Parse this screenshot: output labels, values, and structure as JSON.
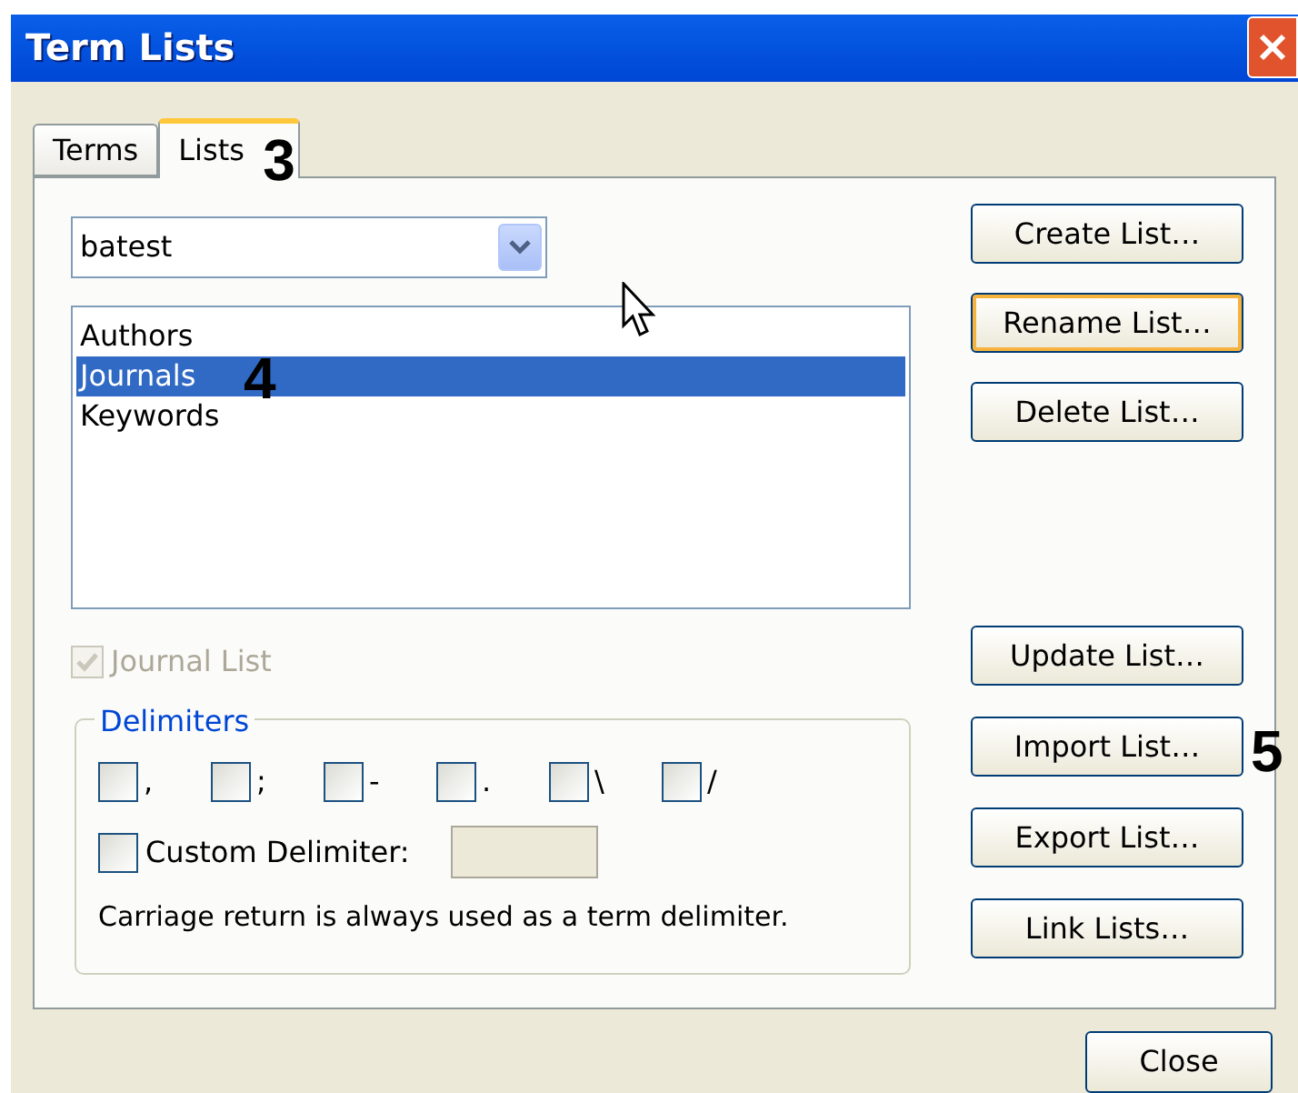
{
  "window": {
    "title": "Term Lists"
  },
  "tabs": [
    {
      "label": "Terms",
      "selected": false
    },
    {
      "label": "Lists",
      "selected": true,
      "annotation": "3"
    }
  ],
  "list_dropdown": {
    "value": "batest"
  },
  "term_lists": [
    {
      "label": "Authors",
      "selected": false
    },
    {
      "label": "Journals",
      "selected": true,
      "annotation": "4"
    },
    {
      "label": "Keywords",
      "selected": false
    }
  ],
  "journal_list": {
    "label": "Journal List",
    "checked": true,
    "disabled": true
  },
  "delimiters": {
    "title": "Delimiters",
    "options": [
      {
        "label": ",",
        "checked": false
      },
      {
        "label": ";",
        "checked": false
      },
      {
        "label": "-",
        "checked": false
      },
      {
        "label": ".",
        "checked": false
      },
      {
        "label": "\\",
        "checked": false
      },
      {
        "label": "/",
        "checked": false
      }
    ],
    "custom": {
      "label": "Custom Delimiter:",
      "checked": false,
      "field_disabled": true
    },
    "note": "Carriage return is always used as a term delimiter."
  },
  "top_buttons": [
    {
      "label": "Create List…",
      "focused": false
    },
    {
      "label": "Rename List…",
      "focused": true
    },
    {
      "label": "Delete List…",
      "focused": false
    }
  ],
  "bottom_buttons": [
    {
      "label": "Update List…",
      "focused": false
    },
    {
      "label": "Import List…",
      "focused": false,
      "annotation": "5"
    },
    {
      "label": "Export List…",
      "focused": false
    },
    {
      "label": "Link Lists…",
      "focused": false
    }
  ],
  "close_button": {
    "label": "Close"
  }
}
